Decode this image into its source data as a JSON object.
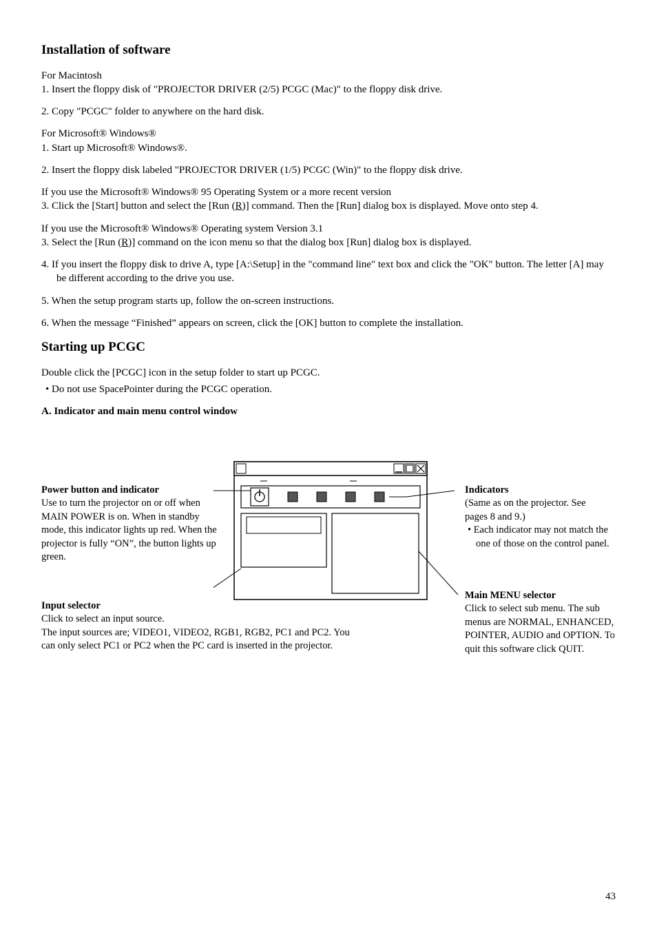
{
  "headings": {
    "install": "Installation of software",
    "starting": "Starting up PCGC",
    "subA": "A. Indicator and main menu control window"
  },
  "install": {
    "mac_title": "For Macintosh",
    "mac1": "1.   Insert the floppy disk of \"PROJECTOR DRIVER (2/5) PCGC (Mac)\" to the floppy disk drive.",
    "mac2": "2.   Copy \"PCGC\" folder to anywhere on the hard disk.",
    "win_title": "For Microsoft® Windows®",
    "win1": "1.   Start up Microsoft® Windows®.",
    "win2": "2.   Insert the floppy disk labeled \"PROJECTOR DRIVER (1/5) PCGC (Win)\" to the floppy disk drive.",
    "if95": "If  you use the Microsoft® Windows® 95 Operating System or a more recent version",
    "win3a_pre": "3.  Click the [Start] button and select the [Run (",
    "win3a_u": "R",
    "win3a_post": ")] command. Then the  [Run] dialog box is displayed. Move onto step 4.",
    "if31": "If  you use the Microsoft® Windows® Operating system Version 3.1",
    "win3b_pre": "3.  Select the [Run (",
    "win3b_u": "R",
    "win3b_post": ")] command on the icon menu so that the dialog box [Run] dialog box is displayed.",
    "win4": "4.  If you insert the floppy disk to drive A, type [A:\\Setup] in the \"command line\" text box and click the \"OK\" button. The letter [A] may be different according to the drive you use.",
    "win5": "5.   When the setup program starts up, follow the on-screen instructions.",
    "win6": "6.   When the message “Finished” appears on screen, click the [OK] button to complete the installation."
  },
  "starting": {
    "p1": "Double click the [PCGC] icon in the setup folder to start up PCGC.",
    "b1": "•  Do not use SpacePointer during the PCGC operation."
  },
  "diagram": {
    "pb_title": "Power button and indicator",
    "pb_body": "Use to turn the projector on or off when MAIN POWER is on. When in standby mode, this indicator lights up red. When the projector is fully “ON”, the button lights up green.",
    "is_title": "Input selector",
    "is_body": "Click to select an input source.\nThe input sources are; VIDEO1, VIDEO2, RGB1, RGB2, PC1 and PC2. You can only select PC1 or PC2 when the PC card is inserted in the projector.",
    "ind_title": "Indicators",
    "ind_l1": "(Same as on the projector. See pages 8 and 9.)",
    "ind_b1": "•  Each indicator may not match the one of those on the control panel.",
    "mm_title": "Main MENU selector",
    "mm_body": "Click to select sub menu. The sub menus are NORMAL, ENHANCED, POINTER, AUDIO and OPTION. To quit this software click QUIT."
  },
  "pagenum": "43"
}
